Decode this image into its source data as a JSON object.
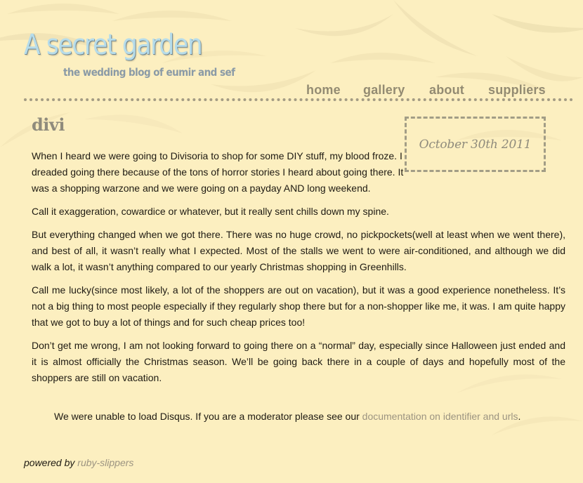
{
  "site": {
    "title": "A secret garden",
    "tagline": "the wedding blog of eumir and sef"
  },
  "nav": {
    "items": [
      {
        "label": "home"
      },
      {
        "label": "gallery"
      },
      {
        "label": "about"
      },
      {
        "label": "suppliers"
      }
    ]
  },
  "post": {
    "title": "divi",
    "date": "October 30th 2011",
    "paragraphs": [
      "When I heard we were going to Divisoria to shop for some DIY stuff, my blood froze. I dreaded going there because of the tons of horror stories I heard about going there. It was a shopping warzone and we were going on a payday AND long weekend.",
      "Call it exaggeration, cowardice or whatever, but it really sent chills down my spine.",
      "But everything changed when we got there. There was no huge crowd, no pickpockets(well at least when we went there), and best of all, it wasn’t really what I expected. Most of the stalls we went to were air-conditioned, and although we did walk a lot, it wasn’t anything compared to our yearly Christmas shopping in Greenhills.",
      "Call me lucky(since most likely, a lot of the shoppers are out on vacation), but it was a good experience nonetheless. It’s not a big thing to most people especially if they regularly shop there but for a non-shopper like me, it was. I am quite happy that we got to buy a lot of things and for such cheap prices too!",
      "Don’t get me wrong, I am not looking forward to going there on a “normal” day, especially since Halloween just ended and it is almost officially the Christmas season. We’ll be going back there in a couple of days and hopefully most of the shoppers are still on vacation."
    ]
  },
  "disqus": {
    "message": "We were unable to load Disqus. If you are a moderator please see our ",
    "link_text": "documentation on identifier and urls",
    "suffix": "."
  },
  "footer": {
    "powered_by": "powered by ",
    "theme_link": "ruby-slippers"
  },
  "colors": {
    "background": "#fcefc0",
    "title": "#b6dcea",
    "nav": "#938b72",
    "link": "#9c9481"
  }
}
